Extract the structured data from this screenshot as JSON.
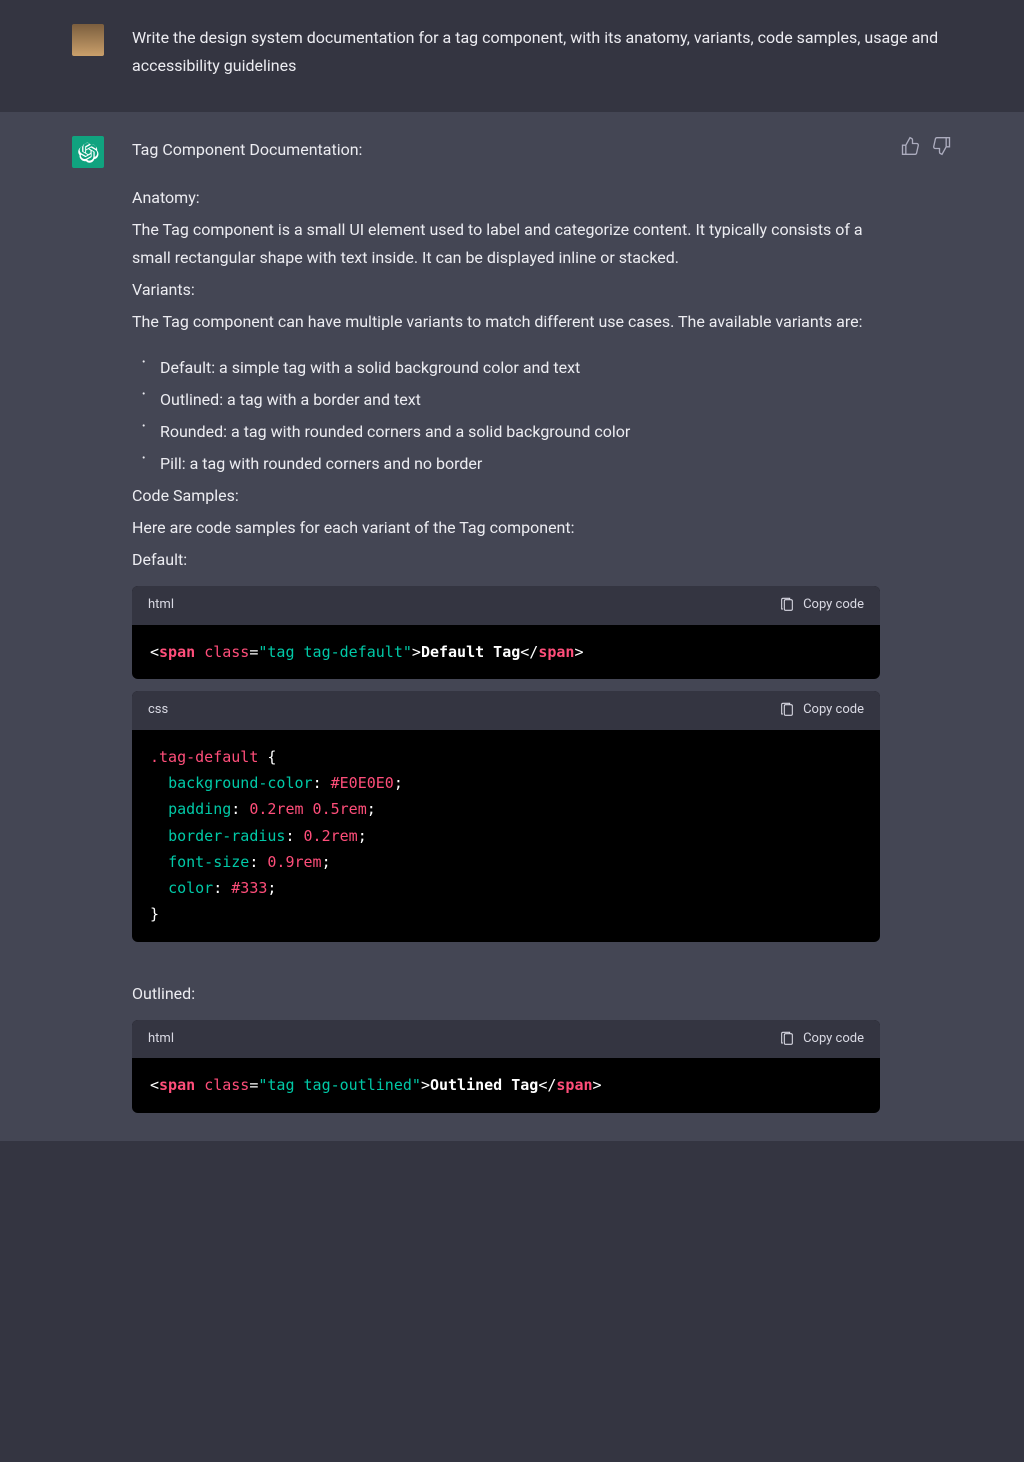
{
  "user": {
    "prompt": "Write the design system documentation for a tag component, with its anatomy, variants, code samples, usage and accessibility guidelines"
  },
  "assistant": {
    "title": "Tag Component Documentation:",
    "anatomy": {
      "heading": "Anatomy:",
      "body": "The Tag component is a small UI element used to label and categorize content. It typically consists of a small rectangular shape with text inside. It can be displayed inline or stacked."
    },
    "variants": {
      "heading": "Variants:",
      "intro": "The Tag component can have multiple variants to match different use cases. The available variants are:",
      "items": [
        "Default: a simple tag with a solid background color and text",
        "Outlined: a tag with a border and text",
        "Rounded: a tag with rounded corners and a solid background color",
        "Pill: a tag with rounded corners and no border"
      ]
    },
    "code_samples": {
      "heading": "Code Samples:",
      "intro": "Here are code samples for each variant of the Tag component:",
      "default_label": "Default:",
      "outlined_label": "Outlined:"
    },
    "code": {
      "lang_html": "html",
      "lang_css": "css",
      "copy_label": "Copy code",
      "default_html": {
        "cls": "tag tag-default",
        "text": "Default Tag"
      },
      "default_css": {
        "selector": ".tag-default",
        "props": [
          {
            "name": "background-color",
            "value": "#E0E0E0"
          },
          {
            "name": "padding",
            "value": "0.2rem 0.5rem"
          },
          {
            "name": "border-radius",
            "value": "0.2rem"
          },
          {
            "name": "font-size",
            "value": "0.9rem"
          },
          {
            "name": "color",
            "value": "#333"
          }
        ]
      },
      "outlined_html": {
        "cls": "tag tag-outlined",
        "text": "Outlined Tag"
      }
    }
  }
}
